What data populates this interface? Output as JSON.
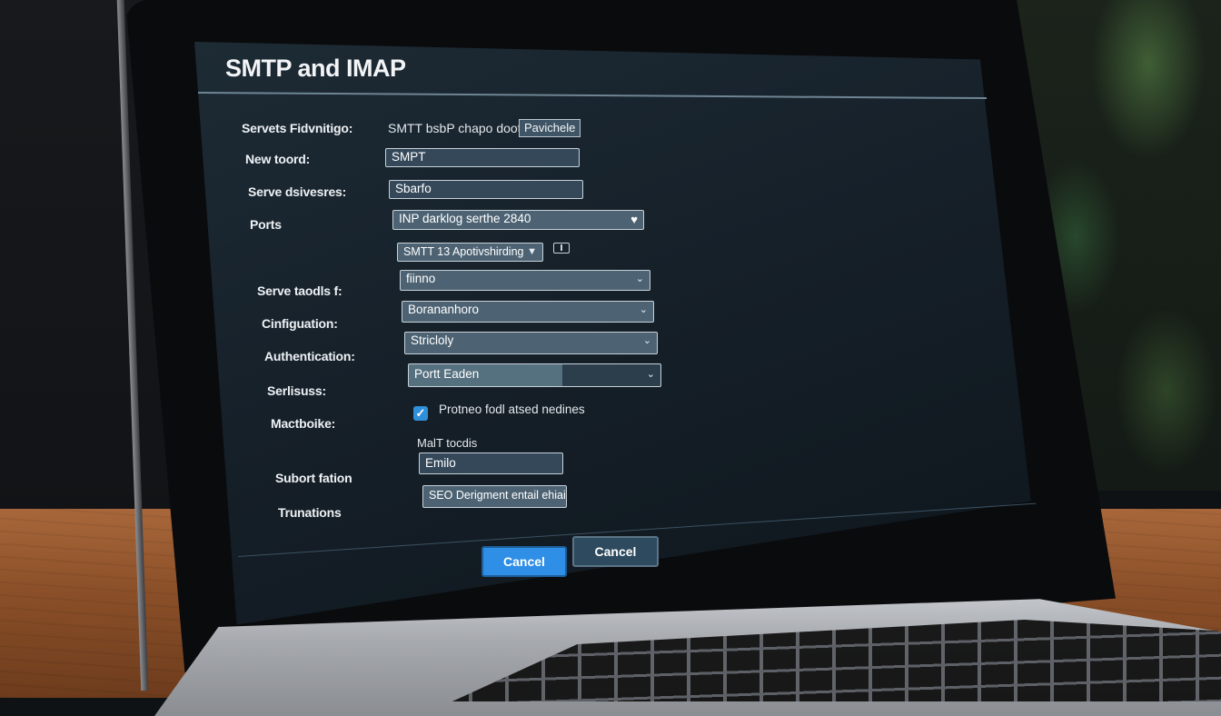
{
  "window": {
    "title": "SMTP and IMAP"
  },
  "form": {
    "rows": [
      {
        "label": "Servets Fidvnitigo:",
        "static_text": "SMTT &#8203;bsbP chapo doote",
        "chip": "Pavichele"
      },
      {
        "label": "New toord:",
        "value": "SMPT"
      },
      {
        "label": "Serve dsivesres:",
        "value": "Sbarfo"
      },
      {
        "label": "Ports",
        "value": "INP darklog serthe 2840",
        "icon": "heart-icon"
      },
      {
        "label": "",
        "value": "SMTT 13 Apotivshirding",
        "icon": "chevron-down-icon"
      },
      {
        "label": "Serve taodls f:",
        "value": "fiinno",
        "icon": "chevron-down-icon"
      },
      {
        "label": "Cinfiguation:",
        "value": "Borananhoro",
        "icon": "chevron-down-icon"
      },
      {
        "label": "Authentication:",
        "value": "Stricloly",
        "icon": "chevron-down-icon"
      },
      {
        "label": "Serlisuss:",
        "value": "Portt Eaden",
        "icon": "chevron-down-icon"
      },
      {
        "label": "Mactboike:",
        "checkbox_label": "Protneo fodl atsed nedines",
        "checked": true
      },
      {
        "label": "",
        "static_text": "MalT tocdis"
      },
      {
        "label": "Subort fation",
        "value": "Emilo"
      },
      {
        "label": "Trunations",
        "value": "SEO Derigment entail ehiaion"
      }
    ]
  },
  "buttons": {
    "primary": "Cancel",
    "secondary": "Cancel"
  },
  "colors": {
    "accent": "#2f8fe6",
    "screen_bg": "#162029",
    "field_bg": "#4d6373"
  }
}
